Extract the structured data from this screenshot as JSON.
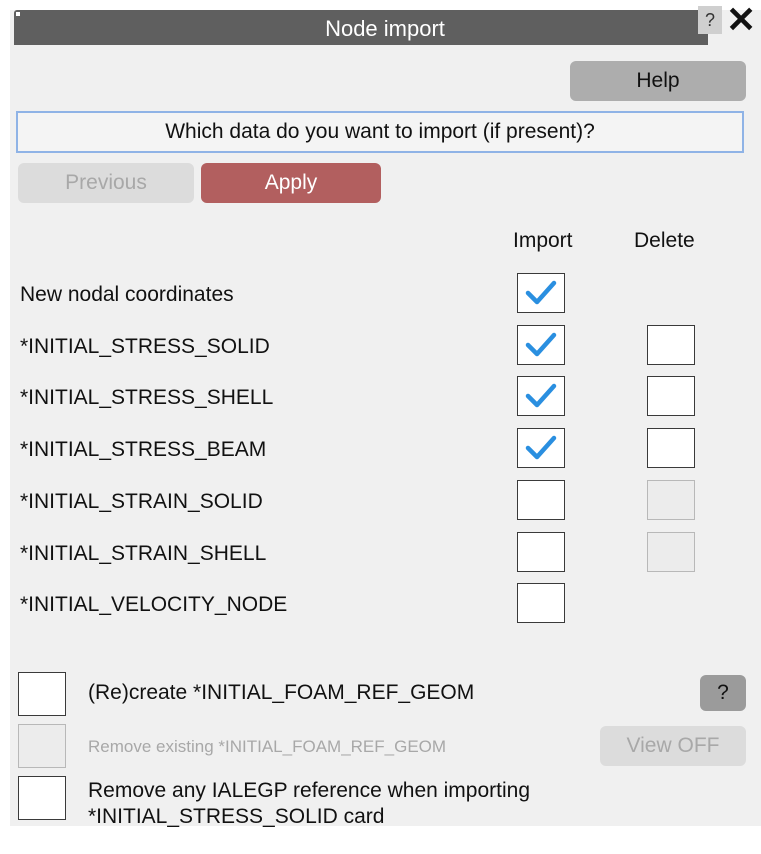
{
  "window": {
    "title": "Node import",
    "help_glyph": "?",
    "close_glyph": "✕"
  },
  "toolbar": {
    "help_label": "Help",
    "previous_label": "Previous",
    "apply_label": "Apply"
  },
  "question": "Which data do you want to import (if present)?",
  "columns": {
    "import": "Import",
    "delete": "Delete"
  },
  "rows": [
    {
      "label": "New nodal coordinates",
      "import_checked": true,
      "delete": "none"
    },
    {
      "label": "*INITIAL_STRESS_SOLID",
      "import_checked": true,
      "delete": "enabled"
    },
    {
      "label": "*INITIAL_STRESS_SHELL",
      "import_checked": true,
      "delete": "enabled"
    },
    {
      "label": "*INITIAL_STRESS_BEAM",
      "import_checked": true,
      "delete": "enabled"
    },
    {
      "label": "*INITIAL_STRAIN_SOLID",
      "import_checked": false,
      "delete": "disabled"
    },
    {
      "label": "*INITIAL_STRAIN_SHELL",
      "import_checked": false,
      "delete": "disabled"
    },
    {
      "label": "*INITIAL_VELOCITY_NODE",
      "import_checked": false,
      "delete": "none"
    }
  ],
  "options": {
    "recreate_label": "(Re)create *INITIAL_FOAM_REF_GEOM",
    "recreate_help": "?",
    "remove_existing_label": "Remove existing *INITIAL_FOAM_REF_GEOM",
    "view_off_label": "View OFF",
    "remove_ialegp_line1": "Remove any IALEGP reference when importing",
    "remove_ialegp_line2": "*INITIAL_STRESS_SOLID card"
  },
  "colors": {
    "titlebar": "#5f5f5f",
    "apply": "#b25f5f",
    "check": "#2a8fe0",
    "panel": "#f0f0f0"
  }
}
